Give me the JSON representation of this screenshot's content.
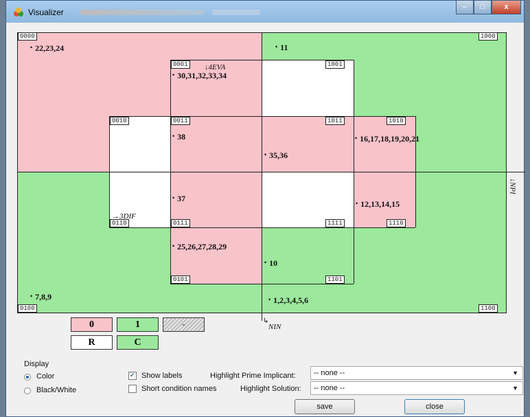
{
  "window": {
    "title": "Visualizer",
    "controls": {
      "minimize": "–",
      "maximize": "□",
      "close": "x"
    }
  },
  "cells": [
    {
      "code": "0000",
      "color": "pink"
    },
    {
      "code": "1000",
      "color": "green"
    },
    {
      "code": "0001",
      "color": "pink"
    },
    {
      "code": "1001",
      "color": "white"
    },
    {
      "code": "0010",
      "color": "white"
    },
    {
      "code": "0011",
      "color": "pink"
    },
    {
      "code": "1011",
      "color": "pink"
    },
    {
      "code": "1010",
      "color": "pink"
    },
    {
      "code": "0110",
      "color": "white"
    },
    {
      "code": "0111",
      "color": "pink"
    },
    {
      "code": "1111",
      "color": "white"
    },
    {
      "code": "1110",
      "color": "pink"
    },
    {
      "code": "0101",
      "color": "pink"
    },
    {
      "code": "1101",
      "color": "green"
    },
    {
      "code": "0100",
      "color": "green"
    },
    {
      "code": "1100",
      "color": "green"
    }
  ],
  "labels": {
    "l1": "22,23,24",
    "l2": "11",
    "l3": "30,31,32,33,34",
    "l4": "38",
    "l5": "35,36",
    "l6": "16,17,18,19,20,21",
    "l7": "37",
    "l8": "12,13,14,15",
    "l9": "25,26,27,28,29",
    "l10": "10",
    "l11": "7,8,9",
    "l12": "1,2,3,4,5,6"
  },
  "conditions": {
    "top": "4EVA",
    "left": "3DIF",
    "right": "NPI",
    "bottom": "NIN"
  },
  "legend": {
    "zero": "0",
    "one": "1",
    "dash": "-",
    "r": "R",
    "c": "C"
  },
  "colors": {
    "pink": "#f9c3ca",
    "green": "#9ce89c",
    "white": "#ffffff"
  },
  "controls": {
    "display_label": "Display",
    "color_option": "Color",
    "bw_option": "Black/White",
    "color_selected": true,
    "show_labels": "Show labels",
    "show_labels_checked": true,
    "short_names": "Short condition names",
    "short_names_checked": false,
    "prime_label": "Highlight Prime Implicant:",
    "prime_value": "-- none --",
    "solution_label": "Highlight Solution:",
    "solution_value": "-- none --",
    "save": "save",
    "close": "close"
  }
}
